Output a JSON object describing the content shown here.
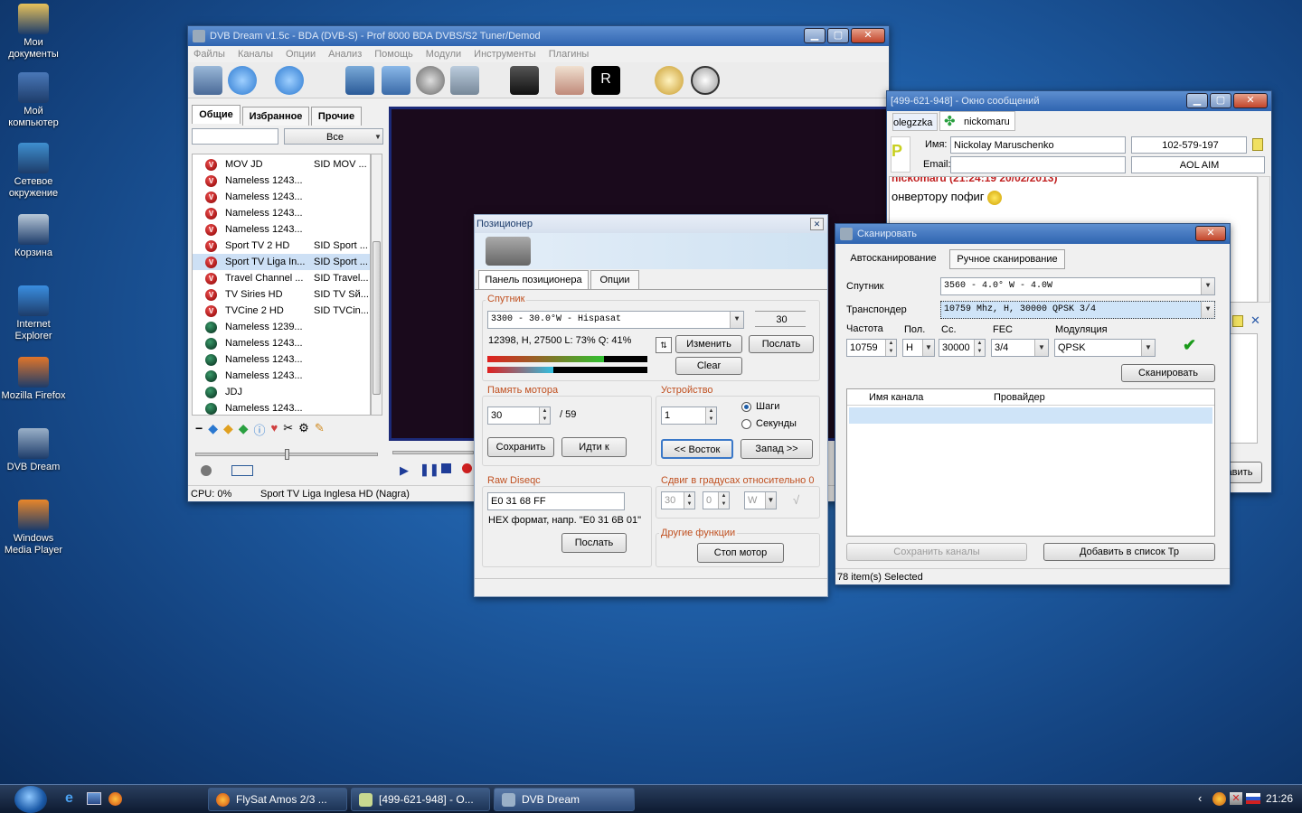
{
  "desktop": {
    "icons": [
      {
        "label": "Мои документы",
        "icon": "folder-documents-icon",
        "color": "#e8c25a"
      },
      {
        "label": "Мой компьютер",
        "icon": "computer-icon",
        "color": "#4a78b8"
      },
      {
        "label": "Сетевое окружение",
        "icon": "network-icon",
        "color": "#3f8fcf"
      },
      {
        "label": "Корзина",
        "icon": "recycle-bin-icon",
        "color": "#b8c8d8"
      },
      {
        "label": "Internet Explorer",
        "icon": "ie-icon",
        "color": "#3a8ee0"
      },
      {
        "label": "Mozilla Firefox",
        "icon": "firefox-icon",
        "color": "#e0752a"
      },
      {
        "label": "DVB Dream",
        "icon": "satellite-dish-icon",
        "color": "#9ab0c8"
      },
      {
        "label": "Windows Media Player",
        "icon": "media-player-icon",
        "color": "#e8862a"
      }
    ]
  },
  "dvb": {
    "title": "DVB Dream v1.5c - BDA (DVB-S) - Prof 8000 BDA DVBS/S2 Tuner/Demod",
    "menu": [
      "Файлы",
      "Каналы",
      "Опции",
      "Анализ",
      "Помощь",
      "Модули",
      "Инструменты",
      "Плагины"
    ],
    "tabs": [
      "Общие",
      "Избранное",
      "Прочие"
    ],
    "filter_value": "Все",
    "channels": [
      {
        "name": "MOV JD",
        "sid": "SID MOV ...",
        "type": "v"
      },
      {
        "name": "Nameless 1243...",
        "sid": "",
        "type": "v"
      },
      {
        "name": "Nameless 1243...",
        "sid": "",
        "type": "v"
      },
      {
        "name": "Nameless 1243...",
        "sid": "",
        "type": "v"
      },
      {
        "name": "Nameless 1243...",
        "sid": "",
        "type": "v"
      },
      {
        "name": "Sport TV 2 HD",
        "sid": "SID Sport ...",
        "type": "v"
      },
      {
        "name": "Sport TV Liga In...",
        "sid": "SID Sport ...",
        "type": "v"
      },
      {
        "name": "Travel Channel ...",
        "sid": "SID Travel...",
        "type": "v"
      },
      {
        "name": "TV Siries HD",
        "sid": "SID TV Sй...",
        "type": "v"
      },
      {
        "name": "TVCine 2 HD",
        "sid": "SID TVCin...",
        "type": "v"
      },
      {
        "name": "Nameless 1239...",
        "sid": "",
        "type": "g"
      },
      {
        "name": "Nameless 1243...",
        "sid": "",
        "type": "g"
      },
      {
        "name": "Nameless 1243...",
        "sid": "",
        "type": "g"
      },
      {
        "name": "Nameless 1243...",
        "sid": "",
        "type": "g"
      },
      {
        "name": "JDJ",
        "sid": "",
        "type": "g"
      },
      {
        "name": "Nameless 1243...",
        "sid": "",
        "type": "g"
      }
    ],
    "status_cpu": "CPU: 0%",
    "status_channel": "Sport TV Liga Inglesa HD (Nagra)"
  },
  "messenger": {
    "title": "[499-621-948] - Окно сообщений",
    "tab1": "olegzzka",
    "tab2": "nickomaru",
    "name_label": "Имя:",
    "name_value": "Nickolay  Maruschenko",
    "uin": "102-579-197",
    "email_label": "Email:",
    "email_value": "",
    "proto": "AOL AIM",
    "msg_header": "nickomaru (21:24:19 20/02/2013)",
    "msg_text": "онвертору пофиг",
    "send_label": "авить"
  },
  "positioner": {
    "title": "Позиционер",
    "tabs": [
      "Панель позиционера",
      "Опции"
    ],
    "sat_group": "Спутник",
    "sat_value": "3300 - 30.0°W - Hispasat",
    "sat_num": "30",
    "signal_text": "12398, H, 27500  L: 73%  Q: 41%",
    "level_pct": 73,
    "quality_pct": 41,
    "btn_change": "Изменить",
    "btn_send": "Послать",
    "btn_clear": "Clear",
    "mem_group": "Память мотора",
    "mem_value": "30",
    "mem_total": "/ 59",
    "btn_save": "Сохранить",
    "btn_goto": "Идти к",
    "dev_group": "Устройство",
    "dev_value": "1",
    "radio_steps": "Шаги",
    "radio_secs": "Секунды",
    "btn_east": "<< Восток",
    "btn_west": "Запад >>",
    "raw_group": "Raw Diseqc",
    "raw_value": "E0 31 68 FF",
    "raw_hint": "HEX формат, напр. \"E0 31 6B 01\"",
    "btn_raw_send": "Послать",
    "shift_group": "Сдвиг в градусах относительно 0",
    "shift_deg": "30",
    "shift_min": "0",
    "shift_dir": "W",
    "other_group": "Другие функции",
    "btn_stop": "Стоп мотор"
  },
  "scan": {
    "title": "Сканировать",
    "tabs": [
      "Автосканирование",
      "Ручное сканирование"
    ],
    "sat_label": "Спутник",
    "sat_value": "3560 -  4.0° W - 4.0W",
    "tp_label": "Транспондер",
    "tp_value": "10759 Mhz, H, 30000   QPSK 3/4",
    "freq_label": "Частота",
    "freq_value": "10759",
    "pol_label": "Пол.",
    "pol_value": "H",
    "sr_label": "Сс.",
    "sr_value": "30000",
    "fec_label": "FEC",
    "fec_value": "3/4",
    "mod_label": "Модуляция",
    "mod_value": "QPSK",
    "btn_scan": "Сканировать",
    "col_channel": "Имя канала",
    "col_provider": "Провайдер",
    "btn_save_channels": "Сохранить каналы",
    "btn_add_tp": "Добавить в список Тр",
    "status": "78 item(s) Selected"
  },
  "taskbar": {
    "tasks": [
      "FlySat Amos 2/3 ...",
      "[499-621-948] - О...",
      "DVB Dream"
    ],
    "clock": "21:26"
  }
}
